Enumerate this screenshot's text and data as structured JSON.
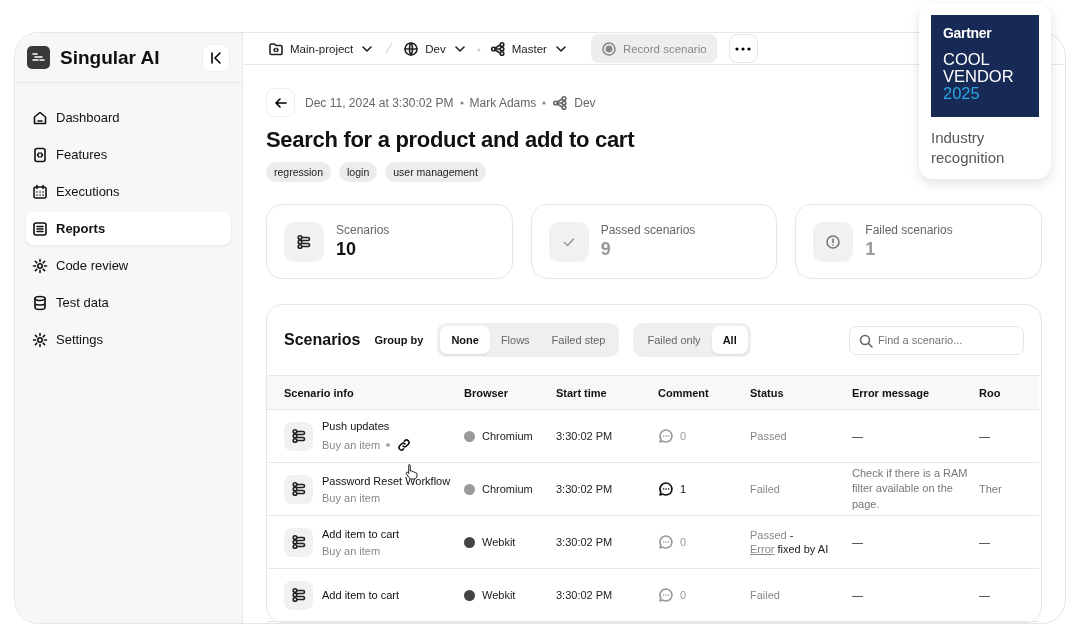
{
  "sidebar": {
    "brand": "Singular AI",
    "items": [
      {
        "label": "Dashboard",
        "selected": false
      },
      {
        "label": "Features",
        "selected": false
      },
      {
        "label": "Executions",
        "selected": false
      },
      {
        "label": "Reports",
        "selected": true
      },
      {
        "label": "Code review",
        "selected": false
      },
      {
        "label": "Test data",
        "selected": false
      },
      {
        "label": "Settings",
        "selected": false
      }
    ]
  },
  "topbar": {
    "project": "Main-project",
    "environment": "Dev",
    "branch": "Master",
    "record_button": {
      "label": "Record scenario",
      "disabled": true
    }
  },
  "header": {
    "timestamp": "Dec 11, 2024 at 3:30:02 PM",
    "author": "Mark Adams",
    "environment": "Dev",
    "title": "Search for a product and add to cart",
    "tags": [
      "regression",
      "login",
      "user management"
    ]
  },
  "stats": [
    {
      "kind": "total",
      "label": "Scenarios",
      "value": "10"
    },
    {
      "kind": "passed",
      "label": "Passed scenarios",
      "value": "9"
    },
    {
      "kind": "failed",
      "label": "Failed scenarios",
      "value": "1"
    }
  ],
  "scenarios": {
    "title": "Scenarios",
    "group_by_label": "Group by",
    "group_by": [
      {
        "label": "None",
        "selected": true
      },
      {
        "label": "Flows",
        "selected": false
      },
      {
        "label": "Failed step",
        "selected": false
      }
    ],
    "filter": [
      {
        "label": "Failed only",
        "selected": false
      },
      {
        "label": "All",
        "selected": true
      }
    ],
    "search": {
      "placeholder": "Find a scenario..."
    },
    "columns": [
      "Scenario info",
      "Browser",
      "Start time",
      "Comment",
      "Status",
      "Error message",
      "Roo"
    ],
    "rows": [
      {
        "name": "Push updates",
        "flow": "Buy an item",
        "has_link": true,
        "browser": "Chromium",
        "color": "#9a9a9a",
        "start_time": "3:30:02 PM",
        "comments": "0",
        "has_comments": false,
        "status": "Passed",
        "error": "—",
        "column_7": "—"
      },
      {
        "name": "Password Reset Workflow",
        "flow": "Buy an item",
        "browser": "Chromium",
        "color": "#9a9a9a",
        "start_time": "3:30:02 PM",
        "comments": "1",
        "has_comments": true,
        "status": "Failed",
        "error": "Check if there is a RAM filter available on the page.",
        "column_7": "Ther"
      },
      {
        "name": "Add item to cart",
        "flow": "Buy an item",
        "browser": "Webkit",
        "color": "#444444",
        "start_time": "3:30:02 PM",
        "comments": "0",
        "has_comments": false,
        "status": "Passed",
        "status_note": {
          "separator": "-",
          "link": "Error",
          "text": "fixed by AI"
        },
        "error": "—",
        "column_7": "—"
      },
      {
        "name": "Add item to cart",
        "browser": "Webkit",
        "color": "#444444",
        "start_time": "3:30:02 PM",
        "comments": "0",
        "has_comments": false,
        "status": "Failed",
        "error": "—",
        "column_7": "—"
      }
    ]
  },
  "badge": {
    "brand": "Gartner",
    "line_1": "COOL",
    "line_2": "VENDOR",
    "year": "2025",
    "caption": "Industry recognition"
  }
}
